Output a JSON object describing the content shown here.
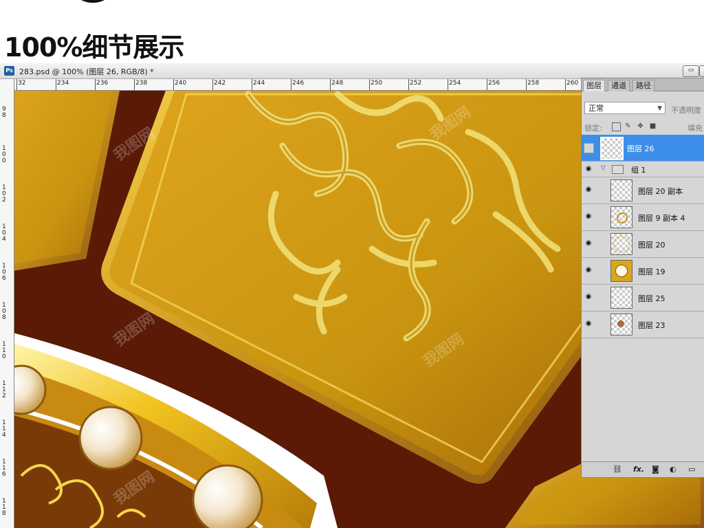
{
  "heading": "100%细节展示",
  "window": {
    "app_icon": "Ps",
    "title": "283.psd @ 100% (图层 26, RGB/8) *",
    "minimize_label": "▭"
  },
  "ruler_h": [
    "32",
    "234",
    "236",
    "238",
    "240",
    "242",
    "244",
    "246",
    "248",
    "250",
    "252",
    "254",
    "256",
    "258",
    "260"
  ],
  "ruler_v": [
    "98",
    "100",
    "102",
    "104",
    "106",
    "108",
    "110",
    "112",
    "114",
    "116",
    "118"
  ],
  "layers_panel": {
    "tabs": [
      "图层",
      "通道",
      "路径"
    ],
    "blend_mode": "正常",
    "opacity_label": "不透明度",
    "lock_label": "锁定:",
    "fill_label": "填充",
    "layers": [
      {
        "name": "图层 26",
        "selected": true,
        "visible": false
      },
      {
        "name": "组 1",
        "group": true,
        "visible": true
      },
      {
        "name": "图层 20 副本",
        "visible": true
      },
      {
        "name": "图层 9 副本 4",
        "visible": true
      },
      {
        "name": "图层 20",
        "visible": true
      },
      {
        "name": "图层 19",
        "visible": true
      },
      {
        "name": "图层 25",
        "visible": true
      },
      {
        "name": "图层 23",
        "visible": true
      }
    ],
    "bottom_icons": [
      "link-icon",
      "fx-icon",
      "mask-icon",
      "adjustment-icon",
      "folder-icon"
    ]
  },
  "colors": {
    "gold": "#d9a81a",
    "dark_red": "#5a1a06",
    "selection": "#3d8ee8"
  }
}
